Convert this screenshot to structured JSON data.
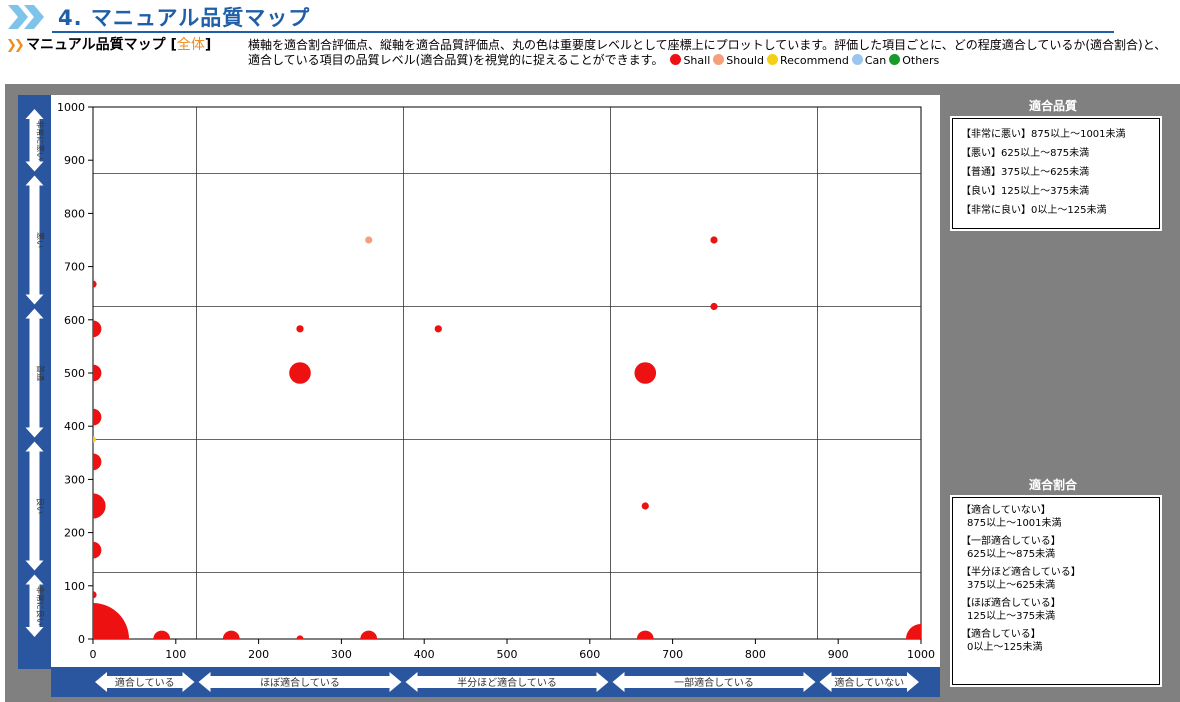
{
  "header": {
    "title": "4. マニュアル品質マップ"
  },
  "intro": {
    "label_prefix": "マニュアル品質マップ [",
    "label_highlight": "全体",
    "label_suffix": "]",
    "description": "横軸を適合割合評価点、縦軸を適合品質評価点、丸の色は重要度レベルとして座標上にプロットしています。評価した項目ごとに、どの程度適合しているか(適合割合)と、適合している項目の品質レベル(適合品質)を視覚的に捉えることができます。"
  },
  "legend": [
    {
      "label": "Shall",
      "color": "#ee1111"
    },
    {
      "label": "Should",
      "color": "#f4a07a"
    },
    {
      "label": "Recommend",
      "color": "#f3cf1a"
    },
    {
      "label": "Can",
      "color": "#9ac6ee"
    },
    {
      "label": "Others",
      "color": "#1a9a2a"
    }
  ],
  "quality_panel": {
    "title": "適合品質",
    "items": [
      "【非常に悪い】875以上～1001未満",
      "【悪い】625以上～875未満",
      "【普通】375以上～625未満",
      "【良い】125以上～375未満",
      "【非常に良い】0以上～125未満"
    ]
  },
  "ratio_panel": {
    "title": "適合割合",
    "items": [
      {
        "name": "【適合していない】",
        "range": "875以上～1001未満"
      },
      {
        "name": "【一部適合している】",
        "range": "625以上～875未満"
      },
      {
        "name": "【半分ほど適合している】",
        "range": "375以上～625未満"
      },
      {
        "name": "【ほぼ適合している】",
        "range": "125以上～375未満"
      },
      {
        "name": "【適合している】",
        "range": "0以上～125未満"
      }
    ]
  },
  "y_bands": [
    "非常に悪い",
    "悪い",
    "普通",
    "良い",
    "非常に良い"
  ],
  "x_bands": [
    "適合している",
    "ほぼ適合している",
    "半分ほど適合している",
    "一部適合している",
    "適合していない"
  ],
  "chart_data": {
    "type": "scatter",
    "title": "",
    "xlabel": "",
    "ylabel": "",
    "xlim": [
      0,
      1000
    ],
    "ylim": [
      0,
      1000
    ],
    "xticks": [
      0,
      100,
      200,
      300,
      400,
      500,
      600,
      700,
      800,
      900,
      1000
    ],
    "yticks": [
      0,
      100,
      200,
      300,
      400,
      500,
      600,
      700,
      800,
      900,
      1000
    ],
    "band_boundaries": [
      125,
      375,
      625,
      875
    ],
    "grid": true,
    "bubble_size_unit": "relative",
    "points": [
      {
        "x": 0,
        "y": 0,
        "size": 6,
        "level": "Shall"
      },
      {
        "x": 0,
        "y": 83,
        "size": 0.6,
        "level": "Shall"
      },
      {
        "x": 0,
        "y": 167,
        "size": 1.4,
        "level": "Shall"
      },
      {
        "x": 0,
        "y": 250,
        "size": 2.1,
        "level": "Shall"
      },
      {
        "x": 0,
        "y": 333,
        "size": 1.4,
        "level": "Shall"
      },
      {
        "x": 0,
        "y": 375,
        "size": 0.5,
        "level": "Recommend"
      },
      {
        "x": 0,
        "y": 417,
        "size": 1.4,
        "level": "Shall"
      },
      {
        "x": 0,
        "y": 500,
        "size": 1.4,
        "level": "Shall"
      },
      {
        "x": 0,
        "y": 583,
        "size": 1.4,
        "level": "Shall"
      },
      {
        "x": 0,
        "y": 667,
        "size": 0.6,
        "level": "Shall"
      },
      {
        "x": 83,
        "y": 0,
        "size": 1.4,
        "level": "Shall"
      },
      {
        "x": 167,
        "y": 0,
        "size": 1.4,
        "level": "Shall"
      },
      {
        "x": 250,
        "y": 0,
        "size": 0.6,
        "level": "Shall"
      },
      {
        "x": 250,
        "y": 500,
        "size": 1.8,
        "level": "Shall"
      },
      {
        "x": 250,
        "y": 583,
        "size": 0.6,
        "level": "Shall"
      },
      {
        "x": 333,
        "y": 0,
        "size": 1.4,
        "level": "Shall"
      },
      {
        "x": 333,
        "y": 750,
        "size": 0.6,
        "level": "Should"
      },
      {
        "x": 417,
        "y": 583,
        "size": 0.6,
        "level": "Shall"
      },
      {
        "x": 667,
        "y": 0,
        "size": 1.4,
        "level": "Shall"
      },
      {
        "x": 667,
        "y": 250,
        "size": 0.6,
        "level": "Shall"
      },
      {
        "x": 667,
        "y": 500,
        "size": 1.8,
        "level": "Shall"
      },
      {
        "x": 750,
        "y": 625,
        "size": 0.6,
        "level": "Shall"
      },
      {
        "x": 750,
        "y": 750,
        "size": 0.6,
        "level": "Shall"
      },
      {
        "x": 1000,
        "y": 0,
        "size": 2.5,
        "level": "Shall"
      }
    ]
  }
}
